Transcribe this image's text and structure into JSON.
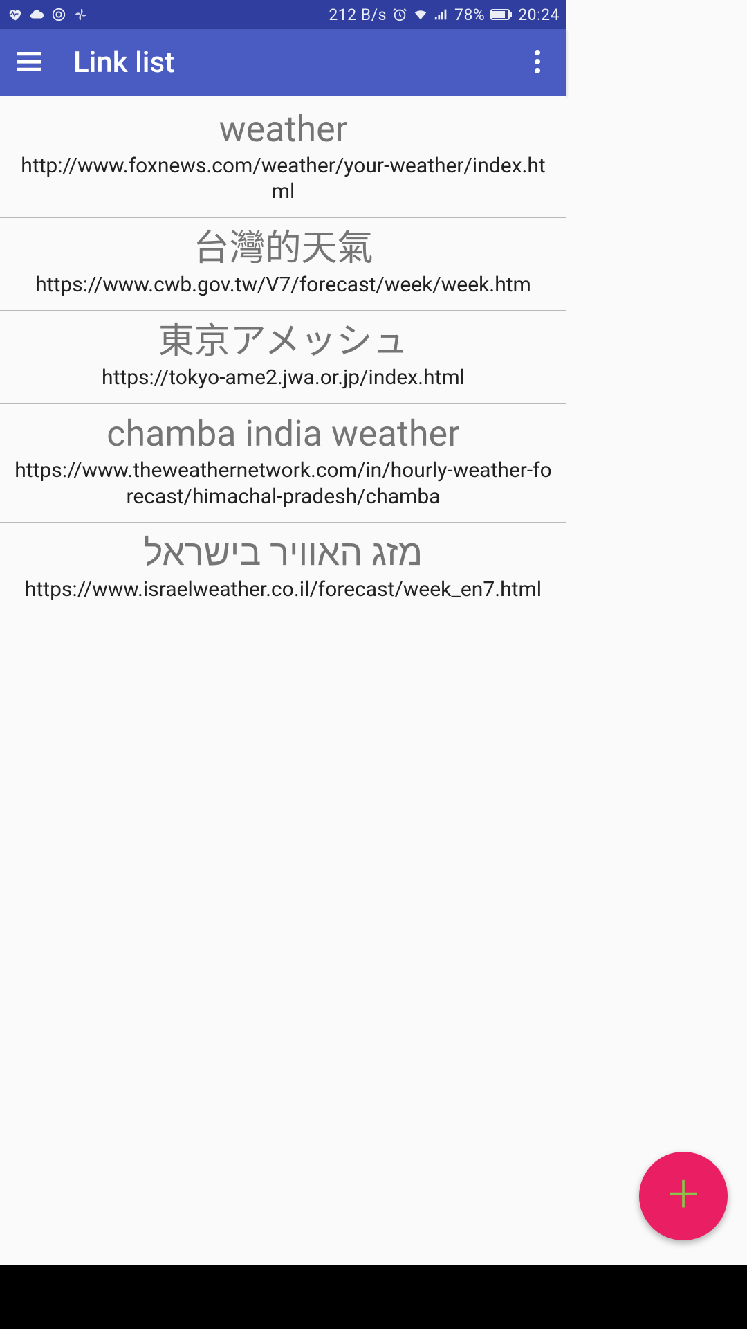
{
  "status": {
    "speed": "212 B/s",
    "battery": "78%",
    "time": "20:24"
  },
  "appbar": {
    "title": "Link list"
  },
  "links": [
    {
      "title": "weather",
      "url": "http://www.foxnews.com/weather/your-weather/index.html"
    },
    {
      "title": "台灣的天氣",
      "url": "https://www.cwb.gov.tw/V7/forecast/week/week.htm"
    },
    {
      "title": "東京アメッシュ",
      "url": "https://tokyo-ame2.jwa.or.jp/index.html"
    },
    {
      "title": "chamba india weather",
      "url": "https://www.theweathernetwork.com/in/hourly-weather-forecast/himachal-pradesh/chamba"
    },
    {
      "title": "מזג האוויר בישראל",
      "url": "https://www.israelweather.co.il/forecast/week_en7.html"
    }
  ]
}
